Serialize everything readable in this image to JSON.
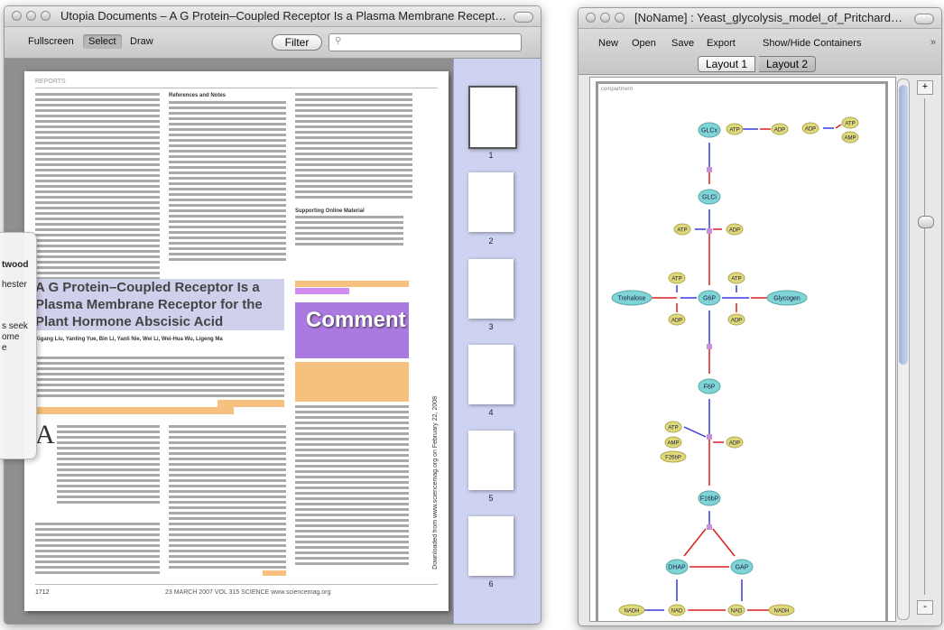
{
  "left_window": {
    "title": "Utopia Documents – A G Protein–Coupled Receptor Is a Plasma Membrane Receptor f...",
    "toolbar": {
      "fullscreen": "Fullscreen",
      "select": "Select",
      "draw": "Draw",
      "filter": "Filter"
    },
    "article": {
      "section": "REPORTS",
      "headline": "A G Protein–Coupled Receptor Is a Plasma Membrane Receptor for the Plant Hormone Abscisic Acid",
      "authors": "Xigang Liu, Yanling Yue, Bin Li, Yanli Nie, Wei Li, Wei-Hua Wu, Ligeng Ma",
      "refs_heading": "References and Notes",
      "supporting": "Supporting Online Material",
      "comment_label": "Comment",
      "vertical_note": "Downloaded from www.sciencemag.org on February 22, 2008",
      "footer_page": "1712",
      "footer_journal": "23 MARCH 2007   VOL 315   SCIENCE   www.sciencemag.org",
      "drop_cap": "A"
    },
    "side_panel": {
      "lines": [
        "twood",
        "",
        "hester",
        "",
        "s seek",
        "ome",
        "e"
      ]
    },
    "thumbnails": [
      "1",
      "2",
      "3",
      "4",
      "5",
      "6"
    ]
  },
  "right_window": {
    "title": "[NoName] : Yeast_glycolysis_model_of_Pritchard_and...",
    "toolbar": {
      "new": "New",
      "open": "Open",
      "save": "Save",
      "export": "Export",
      "show_hide": "Show/Hide Containers",
      "layout1": "Layout 1",
      "layout2": "Layout 2"
    },
    "canvas_label": "compartment",
    "zoom": {
      "plus": "+",
      "minus": "-"
    },
    "nodes": {
      "GLCx": "GLCx",
      "GLCi": "GLCi",
      "G6P": "G6P",
      "F6P": "F6P",
      "F16bP": "F16bP",
      "DHAP": "DHAP",
      "GAP": "GAP",
      "Trehalose": "Trehalose",
      "Glycogen": "Glycogen",
      "ATP": "ATP",
      "ADP": "ADP",
      "AMP": "AMP",
      "F26bP": "F26bP",
      "NADH": "NADH",
      "NAD": "NAD"
    },
    "colors": {
      "metabolite": "#7fd4d6",
      "cofactor": "#dfd97a",
      "substrate_edge": "#3a3adf",
      "product_edge": "#d82020"
    }
  }
}
